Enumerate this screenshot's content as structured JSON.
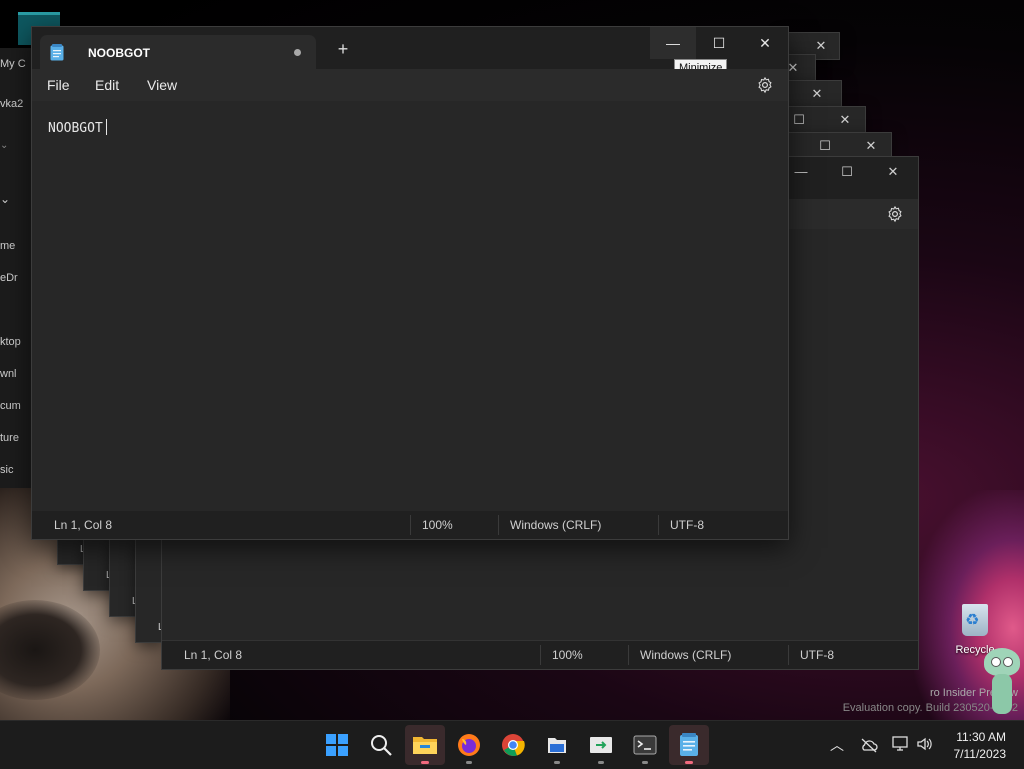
{
  "desktop": {
    "explorer_fragments": [
      "My C",
      "vka2",
      "me",
      "eDr",
      "ktop",
      "wnl",
      "cum",
      "ture",
      "sic"
    ],
    "recycle_bin_label": "Recycle",
    "watermark_line1": "ro Insider Preview",
    "watermark_line2": "Evaluation copy. Build 230520-1332"
  },
  "back_window": {
    "status": {
      "position": "Ln 1, Col 8",
      "zoom": "100%",
      "line_ending": "Windows (CRLF)",
      "encoding": "UTF-8"
    },
    "stack_labels": [
      "L",
      "L",
      "L",
      "L"
    ]
  },
  "main_window": {
    "tab_title": "NOOBGOT",
    "new_tab_symbol": "+",
    "controls": {
      "minimize": "—",
      "maximize": "☐",
      "close": "✕"
    },
    "tooltip": "Minimize",
    "menu": [
      "File",
      "Edit",
      "View"
    ],
    "editor_text": "NOOBGOT",
    "status": {
      "position": "Ln 1, Col 8",
      "zoom": "100%",
      "line_ending": "Windows (CRLF)",
      "encoding": "UTF-8"
    }
  },
  "taskbar": {
    "apps": [
      "start-icon",
      "search-icon",
      "file-explorer-icon",
      "firefox-icon",
      "chrome-icon",
      "files-icon",
      "remote-icon",
      "terminal-icon",
      "notepad-icon"
    ],
    "clock_time": "11:30 AM",
    "clock_date": "7/11/2023"
  }
}
